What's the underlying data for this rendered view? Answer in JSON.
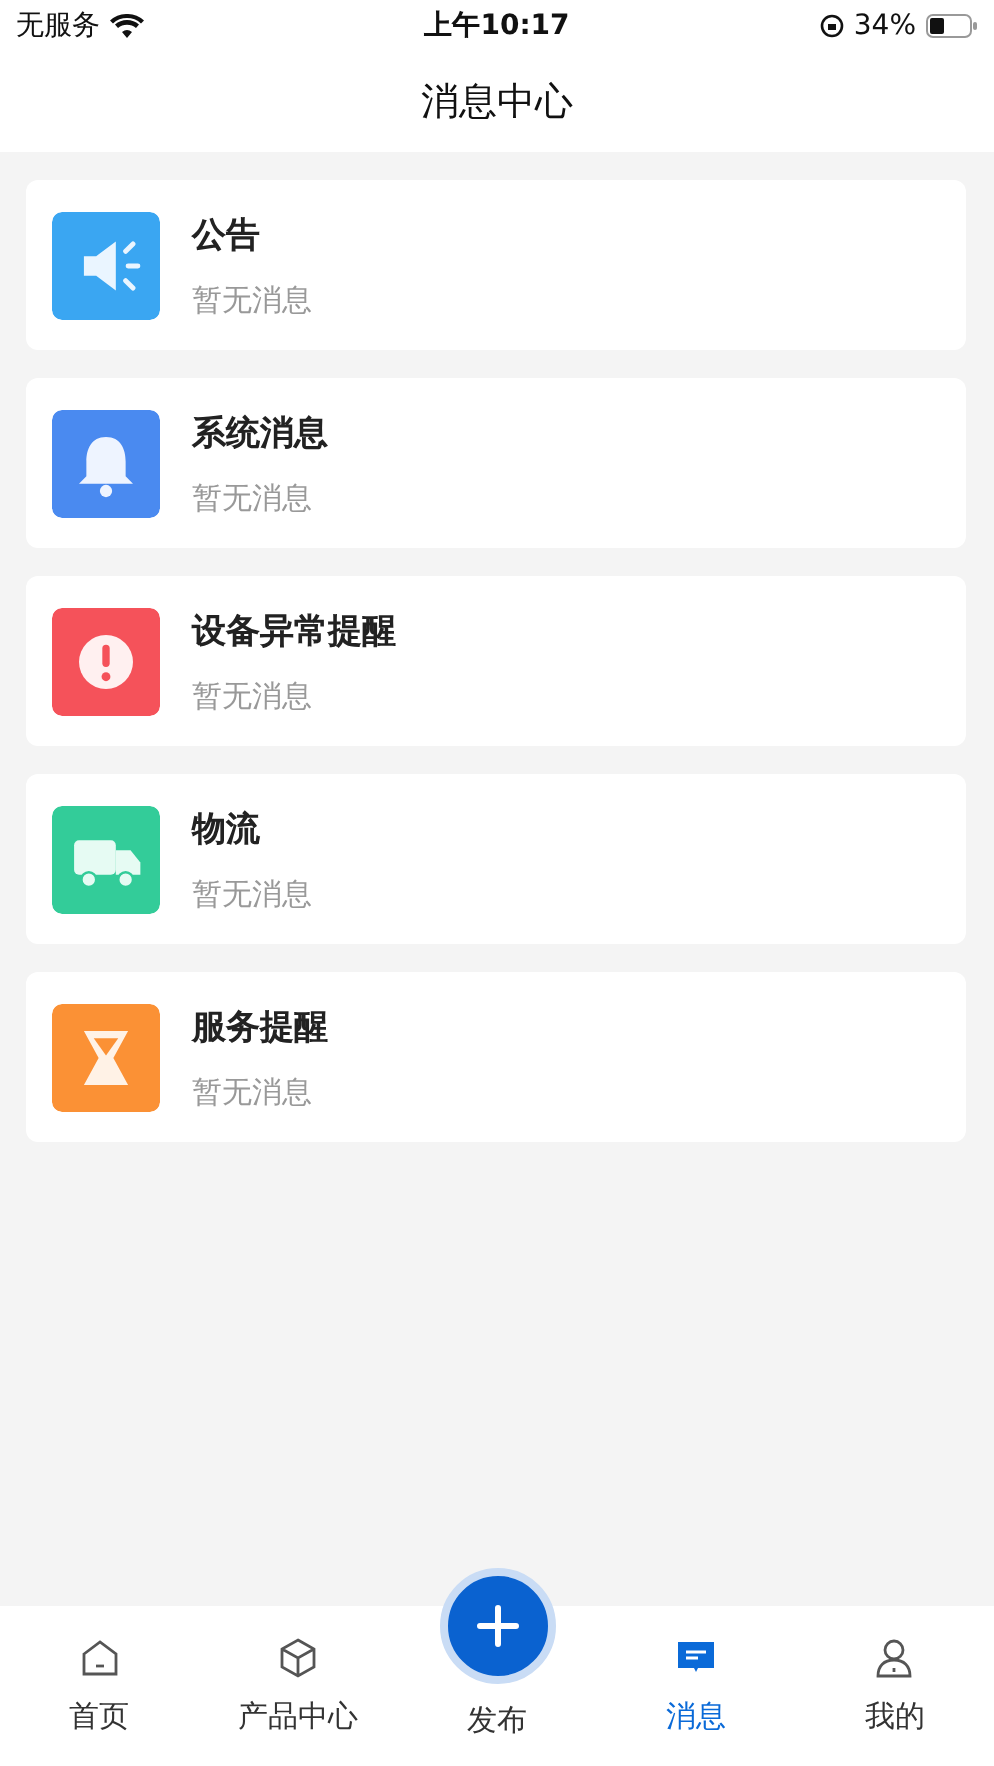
{
  "status_bar": {
    "carrier": "无服务",
    "time": "上午10:17",
    "battery": "34%"
  },
  "header": {
    "title": "消息中心"
  },
  "messages": [
    {
      "kind": "announce",
      "color": "#3aa6f2",
      "title": "公告",
      "preview": "暂无消息"
    },
    {
      "kind": "bell",
      "color": "#4a8af0",
      "title": "系统消息",
      "preview": "暂无消息"
    },
    {
      "kind": "alert",
      "color": "#f5525a",
      "title": "设备异常提醒",
      "preview": "暂无消息"
    },
    {
      "kind": "truck",
      "color": "#33cc99",
      "title": "物流",
      "preview": "暂无消息"
    },
    {
      "kind": "hourglass",
      "color": "#fb9135",
      "title": "服务提醒",
      "preview": "暂无消息"
    }
  ],
  "tab_bar": [
    {
      "kind": "home",
      "label": "首页",
      "selected": false
    },
    {
      "kind": "box",
      "label": "产品中心",
      "selected": false
    },
    {
      "kind": "add",
      "label": "发布",
      "selected": false
    },
    {
      "kind": "message",
      "label": "消息",
      "selected": true
    },
    {
      "kind": "user",
      "label": "我的",
      "selected": false
    }
  ]
}
